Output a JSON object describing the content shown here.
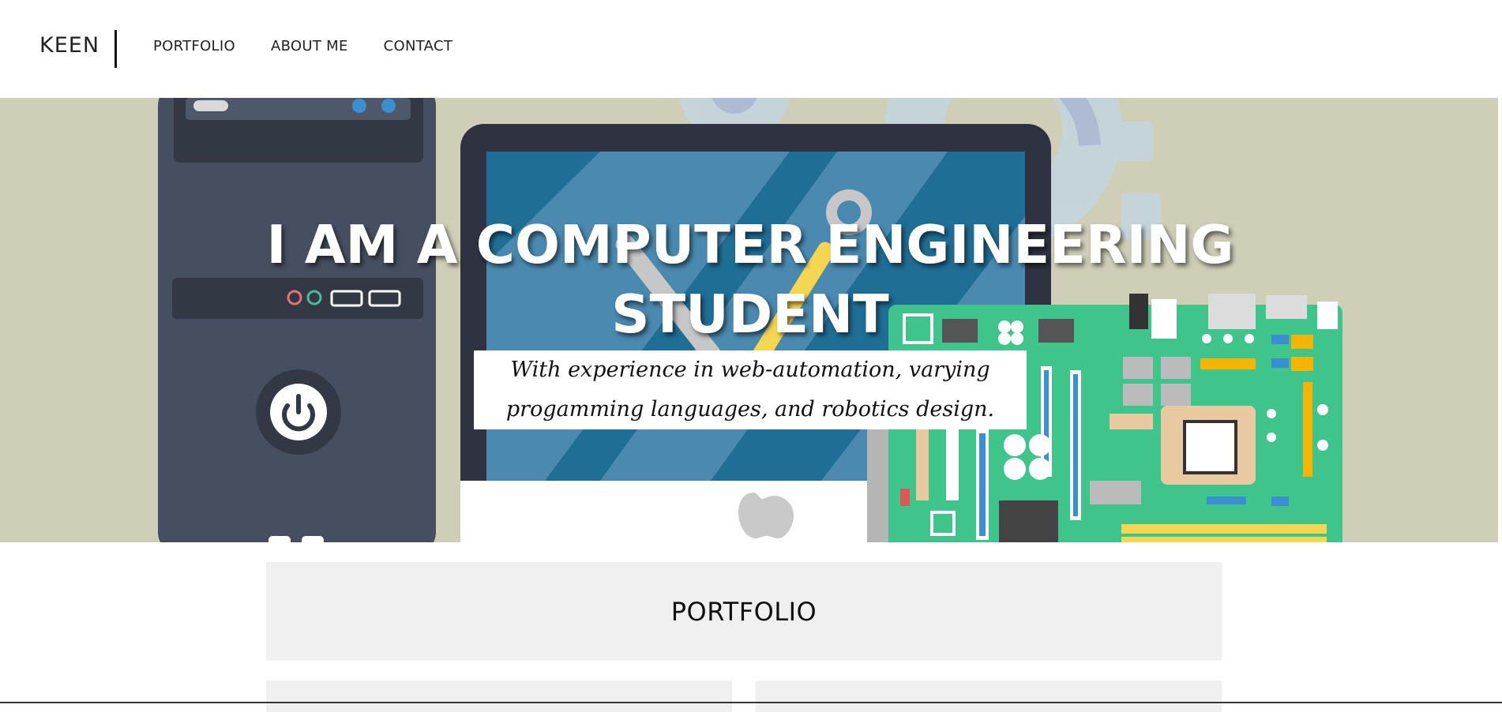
{
  "header": {
    "brand": "KEEN",
    "nav": [
      {
        "label": "PORTFOLIO"
      },
      {
        "label": "ABOUT ME"
      },
      {
        "label": "CONTACT"
      }
    ]
  },
  "hero": {
    "title_line1": "I AM A COMPUTER ENGINEERING",
    "title_line2": "STUDENT",
    "subtitle_line1": "With experience in web-automation, varying",
    "subtitle_line2": "progamming languages, and robotics design.",
    "background_color": "#cfcfb8",
    "illustration": "computer-tower-monitor-motherboard-illustration"
  },
  "portfolio": {
    "title": "PORTFOLIO"
  }
}
